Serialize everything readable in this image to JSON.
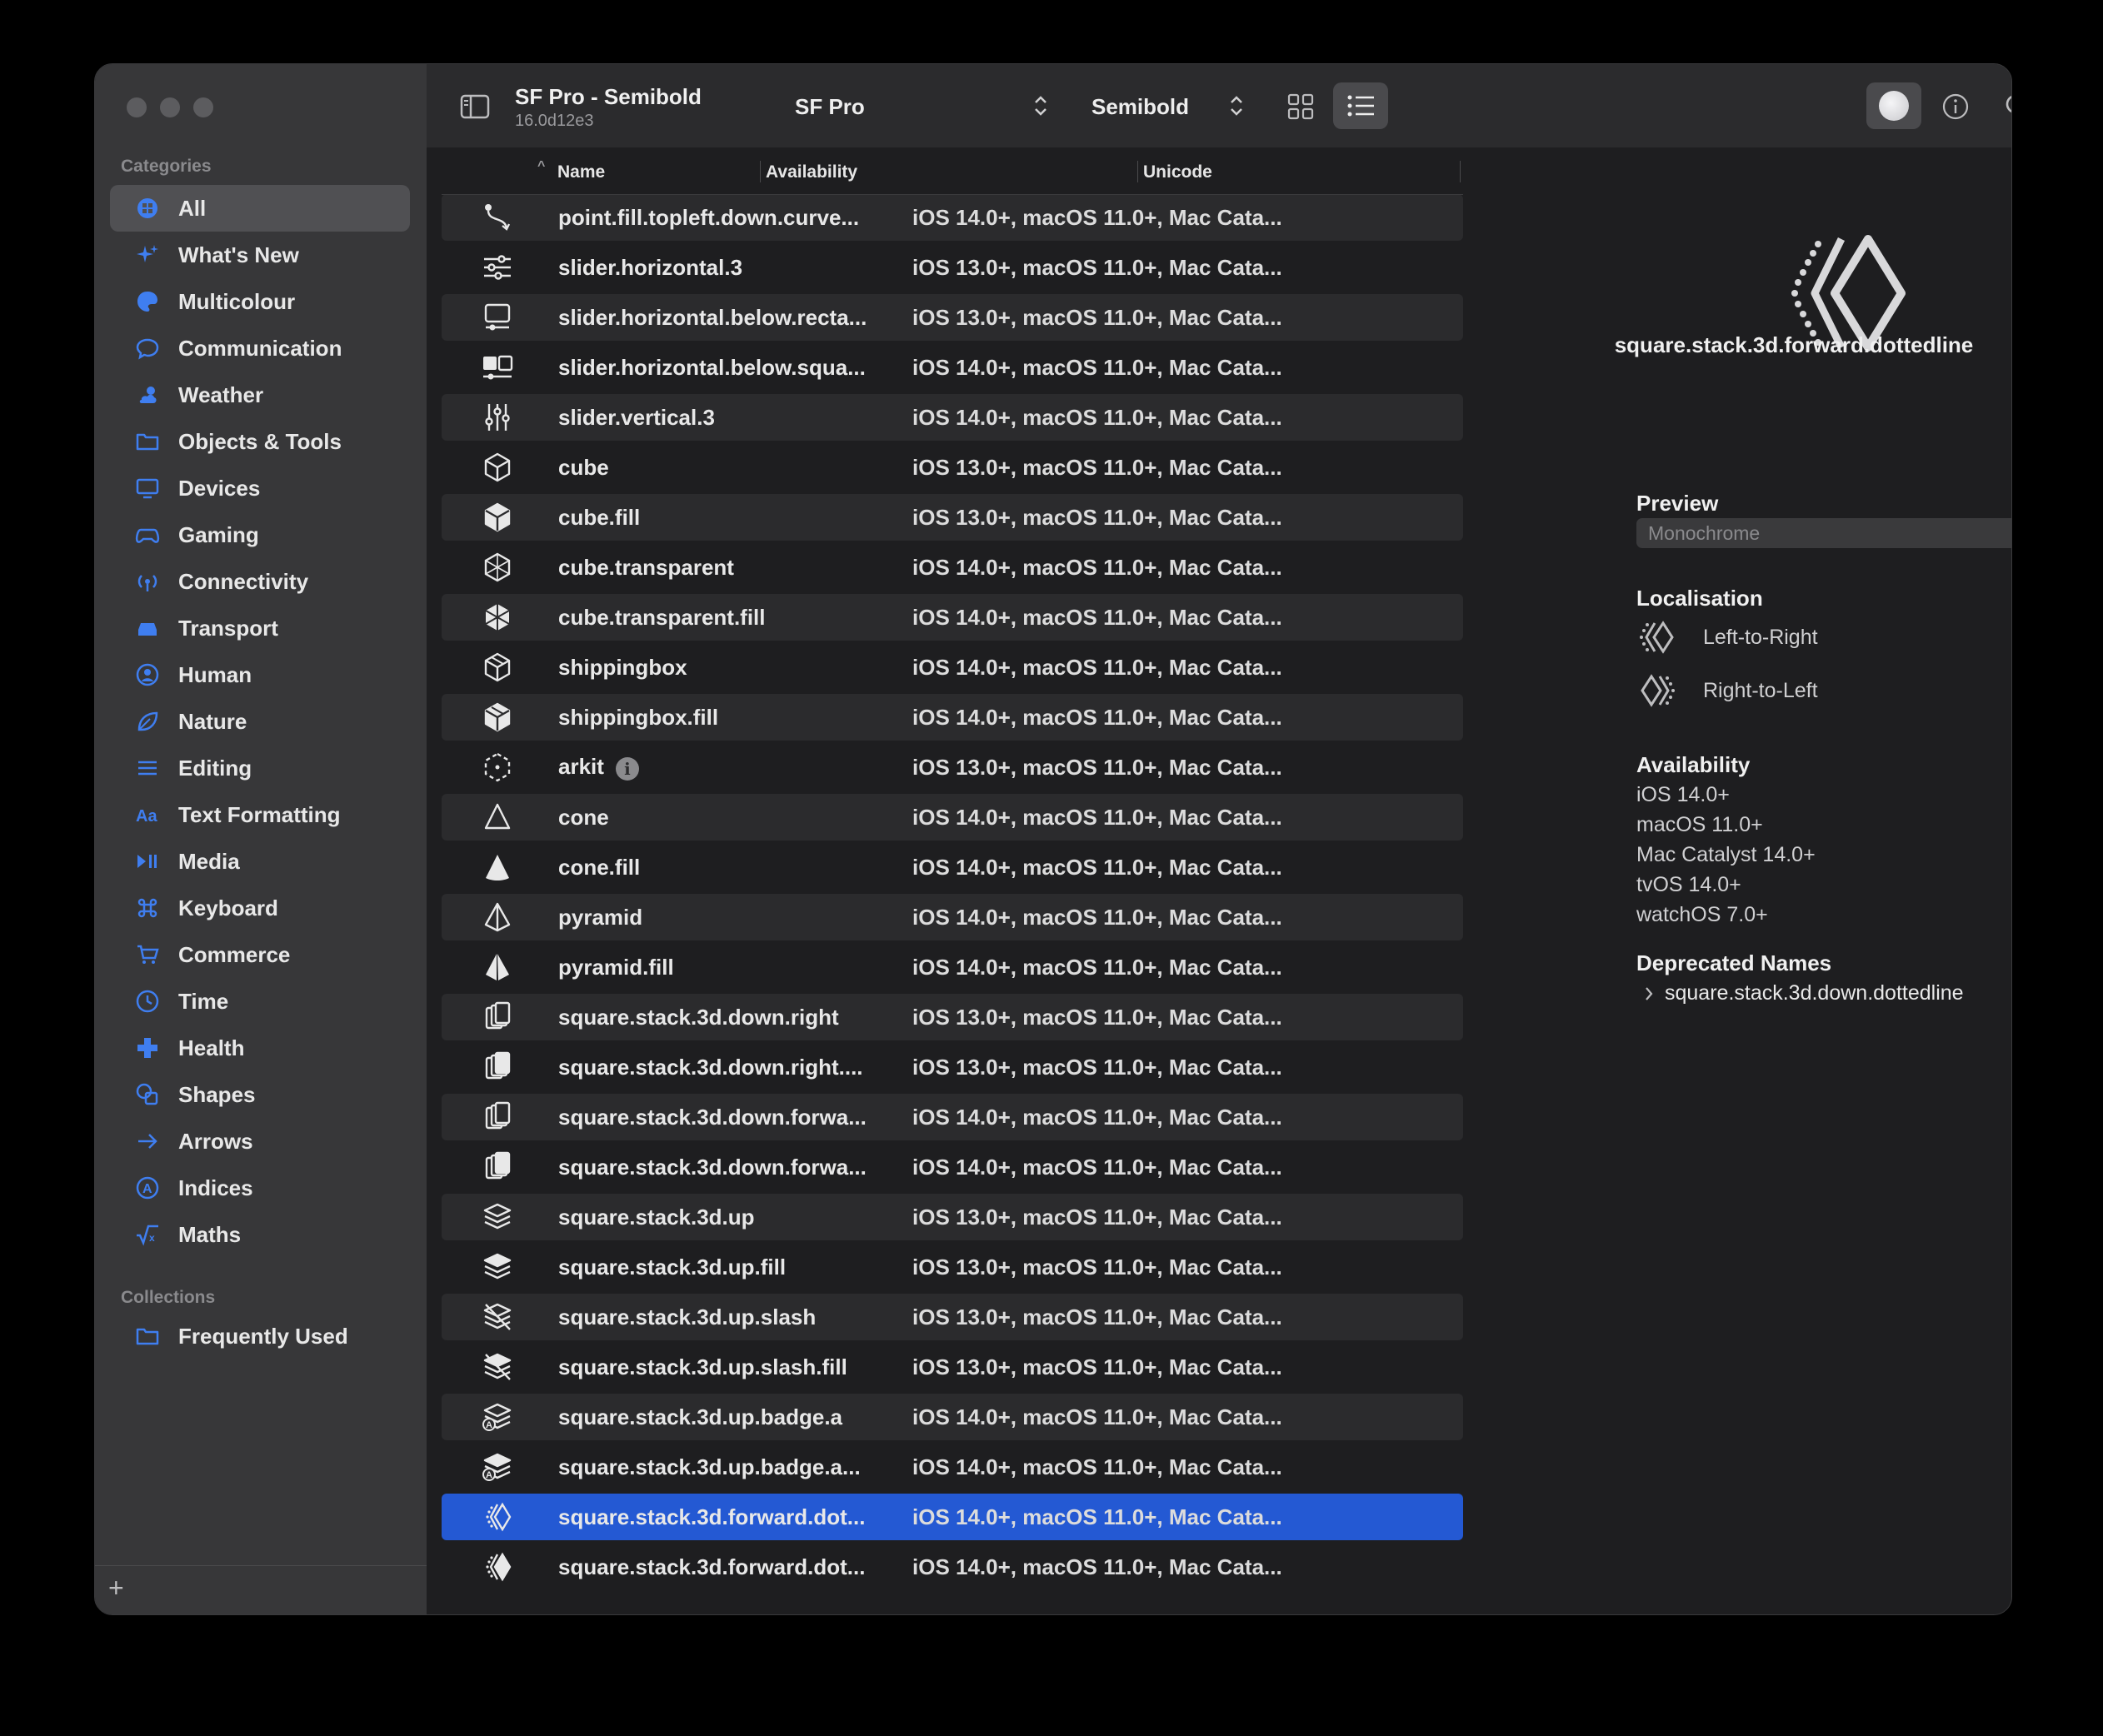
{
  "toolbar": {
    "title": "SF Pro - Semibold",
    "version": "16.0d12e3",
    "font": "SF Pro",
    "weight": "Semibold"
  },
  "sidebar": {
    "categories_label": "Categories",
    "items": [
      {
        "label": "All",
        "icon": "grid-circle-icon"
      },
      {
        "label": "What's New",
        "icon": "sparkles-icon"
      },
      {
        "label": "Multicolour",
        "icon": "paintpalette-icon"
      },
      {
        "label": "Communication",
        "icon": "message-icon"
      },
      {
        "label": "Weather",
        "icon": "cloud-sun-icon"
      },
      {
        "label": "Objects & Tools",
        "icon": "folder-icon"
      },
      {
        "label": "Devices",
        "icon": "desktop-icon"
      },
      {
        "label": "Gaming",
        "icon": "gamecontroller-icon"
      },
      {
        "label": "Connectivity",
        "icon": "antenna-icon"
      },
      {
        "label": "Transport",
        "icon": "car-icon"
      },
      {
        "label": "Human",
        "icon": "person-circle-icon"
      },
      {
        "label": "Nature",
        "icon": "leaf-icon"
      },
      {
        "label": "Editing",
        "icon": "slider-icon"
      },
      {
        "label": "Text Formatting",
        "icon": "textformat-icon"
      },
      {
        "label": "Media",
        "icon": "playpause-icon"
      },
      {
        "label": "Keyboard",
        "icon": "command-icon"
      },
      {
        "label": "Commerce",
        "icon": "cart-icon"
      },
      {
        "label": "Time",
        "icon": "clock-icon"
      },
      {
        "label": "Health",
        "icon": "cross-icon"
      },
      {
        "label": "Shapes",
        "icon": "shapes-icon"
      },
      {
        "label": "Arrows",
        "icon": "arrow-right-icon"
      },
      {
        "label": "Indices",
        "icon": "a-circle-icon"
      },
      {
        "label": "Maths",
        "icon": "sqrt-icon"
      }
    ],
    "collections_label": "Collections",
    "collections": [
      {
        "label": "Frequently Used",
        "icon": "folder-icon"
      }
    ],
    "add_label": "+"
  },
  "columns": {
    "name": "Name",
    "availability": "Availability",
    "unicode": "Unicode"
  },
  "rows": [
    {
      "name": "point.fill.topleft.down.curve...",
      "availability": "iOS 14.0+, macOS 11.0+, Mac Cata...",
      "icon": "curve-icon"
    },
    {
      "name": "slider.horizontal.3",
      "availability": "iOS 13.0+, macOS 11.0+, Mac Cata...",
      "icon": "slider-horizontal-icon"
    },
    {
      "name": "slider.horizontal.below.recta...",
      "availability": "iOS 13.0+, macOS 11.0+, Mac Cata...",
      "icon": "slider-below-rect-icon"
    },
    {
      "name": "slider.horizontal.below.squa...",
      "availability": "iOS 14.0+, macOS 11.0+, Mac Cata...",
      "icon": "slider-below-square-icon"
    },
    {
      "name": "slider.vertical.3",
      "availability": "iOS 14.0+, macOS 11.0+, Mac Cata...",
      "icon": "slider-vertical-icon"
    },
    {
      "name": "cube",
      "availability": "iOS 13.0+, macOS 11.0+, Mac Cata...",
      "icon": "cube-icon"
    },
    {
      "name": "cube.fill",
      "availability": "iOS 13.0+, macOS 11.0+, Mac Cata...",
      "icon": "cube-fill-icon"
    },
    {
      "name": "cube.transparent",
      "availability": "iOS 14.0+, macOS 11.0+, Mac Cata...",
      "icon": "cube-transparent-icon"
    },
    {
      "name": "cube.transparent.fill",
      "availability": "iOS 14.0+, macOS 11.0+, Mac Cata...",
      "icon": "cube-transparent-fill-icon"
    },
    {
      "name": "shippingbox",
      "availability": "iOS 14.0+, macOS 11.0+, Mac Cata...",
      "icon": "shippingbox-icon"
    },
    {
      "name": "shippingbox.fill",
      "availability": "iOS 14.0+, macOS 11.0+, Mac Cata...",
      "icon": "shippingbox-fill-icon"
    },
    {
      "name": "arkit",
      "availability": "iOS 13.0+, macOS 11.0+, Mac Cata...",
      "icon": "arkit-icon",
      "badge": "i"
    },
    {
      "name": "cone",
      "availability": "iOS 14.0+, macOS 11.0+, Mac Cata...",
      "icon": "cone-icon"
    },
    {
      "name": "cone.fill",
      "availability": "iOS 14.0+, macOS 11.0+, Mac Cata...",
      "icon": "cone-fill-icon"
    },
    {
      "name": "pyramid",
      "availability": "iOS 14.0+, macOS 11.0+, Mac Cata...",
      "icon": "pyramid-icon"
    },
    {
      "name": "pyramid.fill",
      "availability": "iOS 14.0+, macOS 11.0+, Mac Cata...",
      "icon": "pyramid-fill-icon"
    },
    {
      "name": "square.stack.3d.down.right",
      "availability": "iOS 13.0+, macOS 11.0+, Mac Cata...",
      "icon": "stack-down-right-icon"
    },
    {
      "name": "square.stack.3d.down.right....",
      "availability": "iOS 13.0+, macOS 11.0+, Mac Cata...",
      "icon": "stack-down-right-fill-icon"
    },
    {
      "name": "square.stack.3d.down.forwa...",
      "availability": "iOS 14.0+, macOS 11.0+, Mac Cata...",
      "icon": "stack-down-forward-icon"
    },
    {
      "name": "square.stack.3d.down.forwa...",
      "availability": "iOS 14.0+, macOS 11.0+, Mac Cata...",
      "icon": "stack-down-forward-fill-icon"
    },
    {
      "name": "square.stack.3d.up",
      "availability": "iOS 13.0+, macOS 11.0+, Mac Cata...",
      "icon": "stack-up-icon"
    },
    {
      "name": "square.stack.3d.up.fill",
      "availability": "iOS 13.0+, macOS 11.0+, Mac Cata...",
      "icon": "stack-up-fill-icon"
    },
    {
      "name": "square.stack.3d.up.slash",
      "availability": "iOS 13.0+, macOS 11.0+, Mac Cata...",
      "icon": "stack-up-slash-icon"
    },
    {
      "name": "square.stack.3d.up.slash.fill",
      "availability": "iOS 13.0+, macOS 11.0+, Mac Cata...",
      "icon": "stack-up-slash-fill-icon"
    },
    {
      "name": "square.stack.3d.up.badge.a",
      "availability": "iOS 14.0+, macOS 11.0+, Mac Cata...",
      "icon": "stack-up-badge-a-icon"
    },
    {
      "name": "square.stack.3d.up.badge.a...",
      "availability": "iOS 14.0+, macOS 11.0+, Mac Cata...",
      "icon": "stack-up-badge-a-fill-icon"
    },
    {
      "name": "square.stack.3d.forward.dot...",
      "availability": "iOS 14.0+, macOS 11.0+, Mac Cata...",
      "icon": "stack-forward-dotted-icon",
      "selected": true
    },
    {
      "name": "square.stack.3d.forward.dot...",
      "availability": "iOS 14.0+, macOS 11.0+, Mac Cata...",
      "icon": "stack-forward-dotted-fill-icon"
    }
  ],
  "inspector": {
    "symbol_name": "square.stack.3d.forward.dottedline",
    "preview_label": "Preview",
    "preview_mode": "Monochrome",
    "localisation_label": "Localisation",
    "ltr_label": "Left-to-Right",
    "rtl_label": "Right-to-Left",
    "availability_label": "Availability",
    "availability": [
      "iOS 14.0+",
      "macOS 11.0+",
      "Mac Catalyst 14.0+",
      "tvOS 14.0+",
      "watchOS 7.0+"
    ],
    "deprecated_label": "Deprecated Names",
    "deprecated_name": "square.stack.3d.down.dottedline"
  },
  "colors": {
    "accent": "#2459d3",
    "sidebar_icon": "#3f7ef0"
  }
}
